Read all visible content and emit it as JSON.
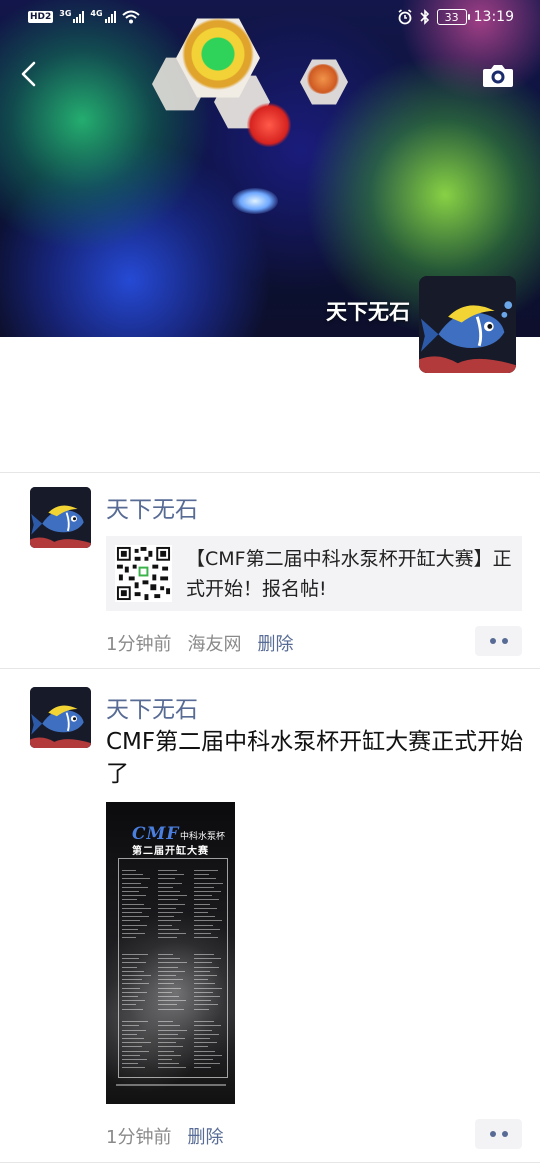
{
  "status_bar": {
    "hd_badge": "HD",
    "hd_num": "2",
    "sim1_label": "3G",
    "sim2_label": "4G",
    "battery": "33",
    "time": "13:19"
  },
  "cover": {
    "profile_name": "天下无石"
  },
  "posts": [
    {
      "author": "天下无石",
      "share_title": "【CMF第二届中科水泵杯开缸大赛】正式开始！报名帖!",
      "time": "1分钟前",
      "source": "海友网",
      "delete_label": "删除"
    },
    {
      "author": "天下无石",
      "text": "CMF第二届中科水泵杯开缸大赛正式开始了",
      "poster": {
        "logo": "CMF",
        "subtitle_1": "中科水泵杯",
        "subtitle_2": "第二届开缸大赛"
      },
      "time": "1分钟前",
      "delete_label": "删除"
    }
  ],
  "icons": {
    "back": "back-chevron-icon",
    "camera": "camera-icon",
    "alarm": "alarm-icon",
    "bluetooth": "bluetooth-icon",
    "wifi": "wifi-icon",
    "more": "more-dots-icon"
  },
  "colors": {
    "link": "#576b95",
    "meta": "#8a8a8a",
    "card_bg": "#f3f3f5"
  }
}
